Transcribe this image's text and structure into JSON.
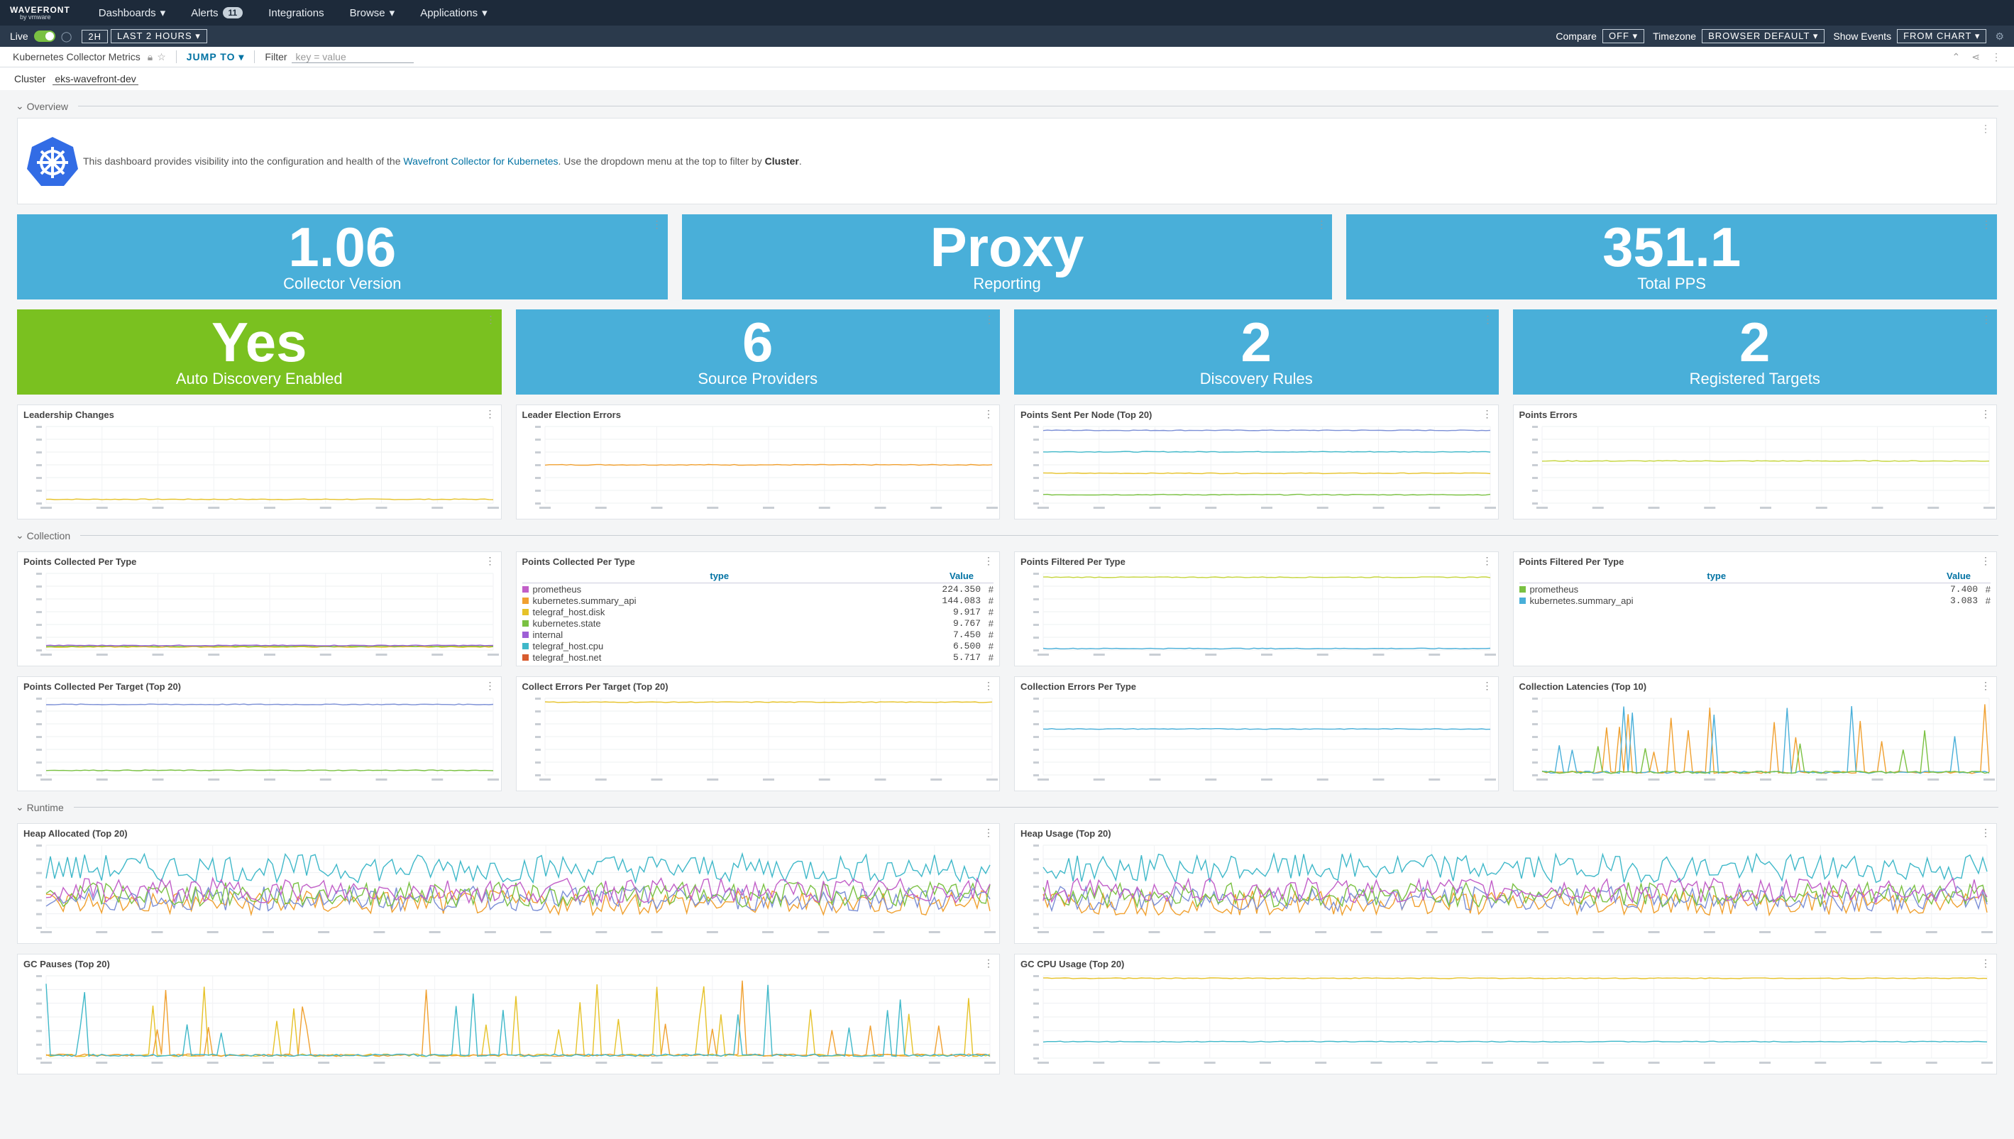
{
  "nav": {
    "logo_top": "WAVEFRONT",
    "logo_bottom": "by vmware",
    "dashboards": "Dashboards",
    "alerts": "Alerts",
    "alerts_count": "11",
    "integrations": "Integrations",
    "browse": "Browse",
    "applications": "Applications"
  },
  "timebar": {
    "live": "Live",
    "range_short": "2H",
    "range_label": "LAST 2 HOURS",
    "compare_label": "Compare",
    "compare_value": "OFF",
    "timezone_label": "Timezone",
    "timezone_value": "BROWSER DEFAULT",
    "show_events_label": "Show Events",
    "show_events_value": "FROM CHART"
  },
  "dashbar": {
    "title": "Kubernetes Collector Metrics",
    "jump_to": "JUMP TO",
    "filter_label": "Filter",
    "filter_placeholder": "key = value"
  },
  "cluster": {
    "label": "Cluster",
    "value": "eks-wavefront-dev"
  },
  "sections": {
    "overview": "Overview",
    "collection": "Collection",
    "runtime": "Runtime"
  },
  "description": {
    "pre": "This dashboard provides visibility into the configuration and health of the ",
    "link": "Wavefront Collector for Kubernetes",
    "post": ". Use the dropdown menu at the top to filter by ",
    "bold": "Cluster",
    "end": "."
  },
  "stats_row1": [
    {
      "value": "1.06",
      "label": "Collector Version"
    },
    {
      "value": "Proxy",
      "label": "Reporting"
    },
    {
      "value": "351.1",
      "label": "Total PPS"
    }
  ],
  "stats_row2": [
    {
      "value": "Yes",
      "label": "Auto Discovery Enabled"
    },
    {
      "value": "6",
      "label": "Source Providers"
    },
    {
      "value": "2",
      "label": "Discovery Rules"
    },
    {
      "value": "2",
      "label": "Registered Targets"
    }
  ],
  "panels": {
    "leadership_changes": "Leadership Changes",
    "leader_election_errors": "Leader Election Errors",
    "points_sent_per_node": "Points Sent Per Node (Top 20)",
    "points_errors": "Points Errors",
    "points_collected_per_type": "Points Collected Per Type",
    "points_collected_per_type_tbl": "Points Collected Per Type",
    "points_filtered_per_type": "Points Filtered Per Type",
    "points_filtered_per_type_tbl": "Points Filtered Per Type",
    "points_collected_per_target": "Points Collected Per Target (Top 20)",
    "collect_errors_per_target": "Collect Errors Per Target (Top 20)",
    "collection_errors_per_type": "Collection Errors Per Type",
    "collection_latencies": "Collection Latencies (Top 10)",
    "heap_allocated": "Heap Allocated (Top 20)",
    "heap_usage": "Heap Usage (Top 20)",
    "gc_pauses": "GC Pauses (Top 20)",
    "gc_cpu_usage": "GC CPU Usage (Top 20)"
  },
  "table_collected": {
    "col_type": "type",
    "col_value": "Value",
    "rows": [
      {
        "name": "prometheus",
        "value": "224.350",
        "color": "#c25fc8"
      },
      {
        "name": "kubernetes.summary_api",
        "value": "144.083",
        "color": "#f0a030"
      },
      {
        "name": "telegraf_host.disk",
        "value": "9.917",
        "color": "#e6c229"
      },
      {
        "name": "kubernetes.state",
        "value": "9.767",
        "color": "#7ac142"
      },
      {
        "name": "internal",
        "value": "7.450",
        "color": "#9e5fd6"
      },
      {
        "name": "telegraf_host.cpu",
        "value": "6.500",
        "color": "#3fb8c9"
      },
      {
        "name": "telegraf_host.net",
        "value": "5.717",
        "color": "#d85c2f"
      }
    ]
  },
  "table_filtered": {
    "col_type": "type",
    "col_value": "Value",
    "rows": [
      {
        "name": "prometheus",
        "value": "7.400",
        "color": "#7ac142"
      },
      {
        "name": "kubernetes.summary_api",
        "value": "3.083",
        "color": "#49afd9"
      }
    ]
  },
  "colors": {
    "stat_blue": "#49afd9",
    "stat_green": "#7ac120",
    "nav_bg": "#1d2a3a"
  }
}
